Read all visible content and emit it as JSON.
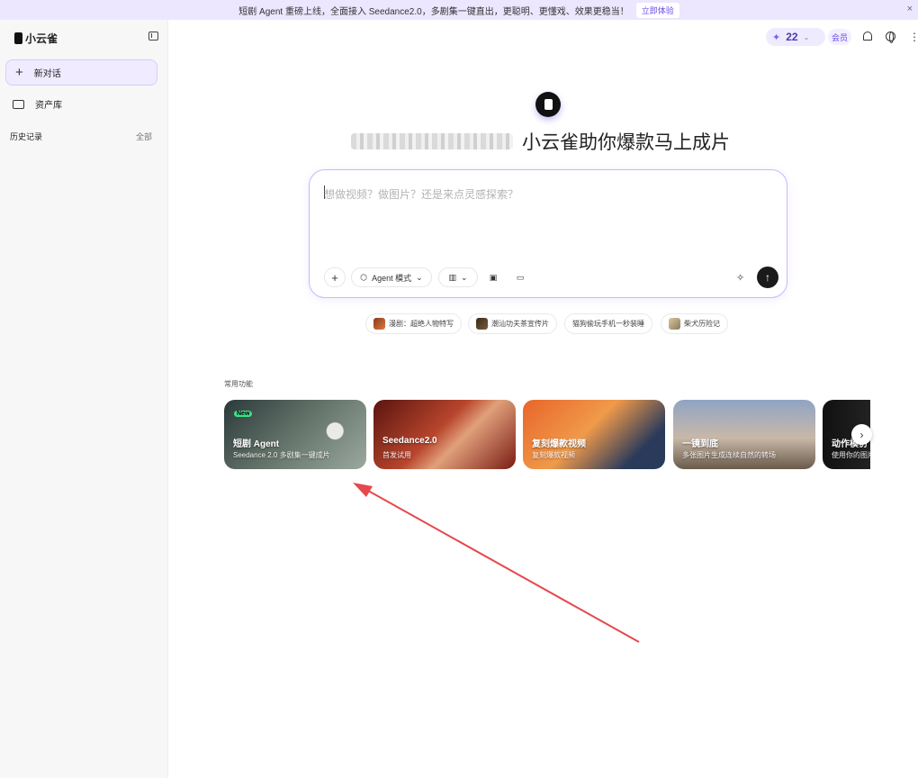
{
  "banner": {
    "text": "短剧 Agent 重磅上线，全面接入 Seedance2.0，多剧集一键直出，更聪明、更懂戏、效果更稳当！",
    "cta": "立即体验",
    "close": "×"
  },
  "app": {
    "name": "小云雀"
  },
  "sidebar": {
    "new_chat": "新对话",
    "assets": "资产库",
    "history_label": "历史记录",
    "history_all": "全部"
  },
  "topbar": {
    "credits": "22",
    "member": "会员"
  },
  "hero": {
    "headline": "小云雀助你爆款马上成片"
  },
  "composer": {
    "placeholder": "想做视频？做图片？还是来点灵感探索？",
    "mode": "Agent 模式",
    "send": "↑"
  },
  "chips": [
    "漫剧：超绝人物特写",
    "潮汕功夫茶宣传片",
    "猫狗偷玩手机一秒装睡",
    "柴犬历险记"
  ],
  "features": {
    "title": "常用功能",
    "cards": [
      {
        "title": "短剧 Agent",
        "subtitle": "Seedance 2.0 多剧集一键成片",
        "badge": "New"
      },
      {
        "title": "Seedance2.0",
        "subtitle": "首发试用"
      },
      {
        "title": "复刻爆款视频",
        "subtitle": "复刻爆款视频"
      },
      {
        "title": "一镜到底",
        "subtitle": "多张图片生成连续自然的转场"
      },
      {
        "title": "动作模仿",
        "subtitle": "使用你的图片"
      }
    ]
  },
  "colors": {
    "accent": "#6d4ce8",
    "banner_bg": "#ece6ff",
    "arrow": "#e5484d"
  }
}
